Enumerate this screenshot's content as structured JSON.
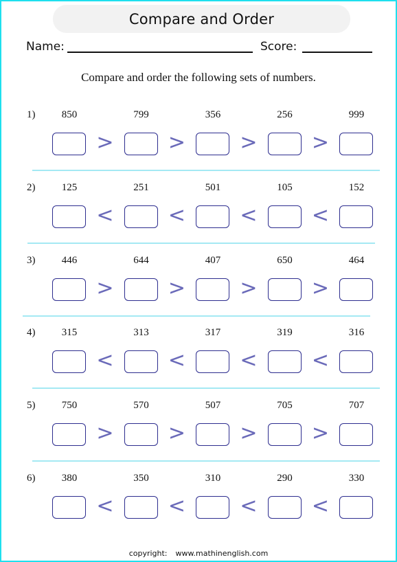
{
  "title": "Compare and Order",
  "name_label": "Name:",
  "score_label": "Score:",
  "instructions": "Compare and order the following sets of numbers.",
  "problems": [
    {
      "label": "1)",
      "numbers": [
        "850",
        "799",
        "356",
        "256",
        "999"
      ],
      "symbol": ">"
    },
    {
      "label": "2)",
      "numbers": [
        "125",
        "251",
        "501",
        "105",
        "152"
      ],
      "symbol": "<"
    },
    {
      "label": "3)",
      "numbers": [
        "446",
        "644",
        "407",
        "650",
        "464"
      ],
      "symbol": ">"
    },
    {
      "label": "4)",
      "numbers": [
        "315",
        "313",
        "317",
        "319",
        "316"
      ],
      "symbol": "<"
    },
    {
      "label": "5)",
      "numbers": [
        "750",
        "570",
        "507",
        "705",
        "707"
      ],
      "symbol": ">"
    },
    {
      "label": "6)",
      "numbers": [
        "380",
        "350",
        "310",
        "290",
        "330"
      ],
      "symbol": "<"
    }
  ],
  "copyright_label": "copyright:",
  "copyright_site": "www.mathinenglish.com",
  "colors": {
    "page_border": "#1ee0ee",
    "box_border": "#2c2c8e",
    "symbol": "#6a6ab9",
    "divider": "#a4e9f3",
    "title_banner": "#f2f2f2"
  }
}
